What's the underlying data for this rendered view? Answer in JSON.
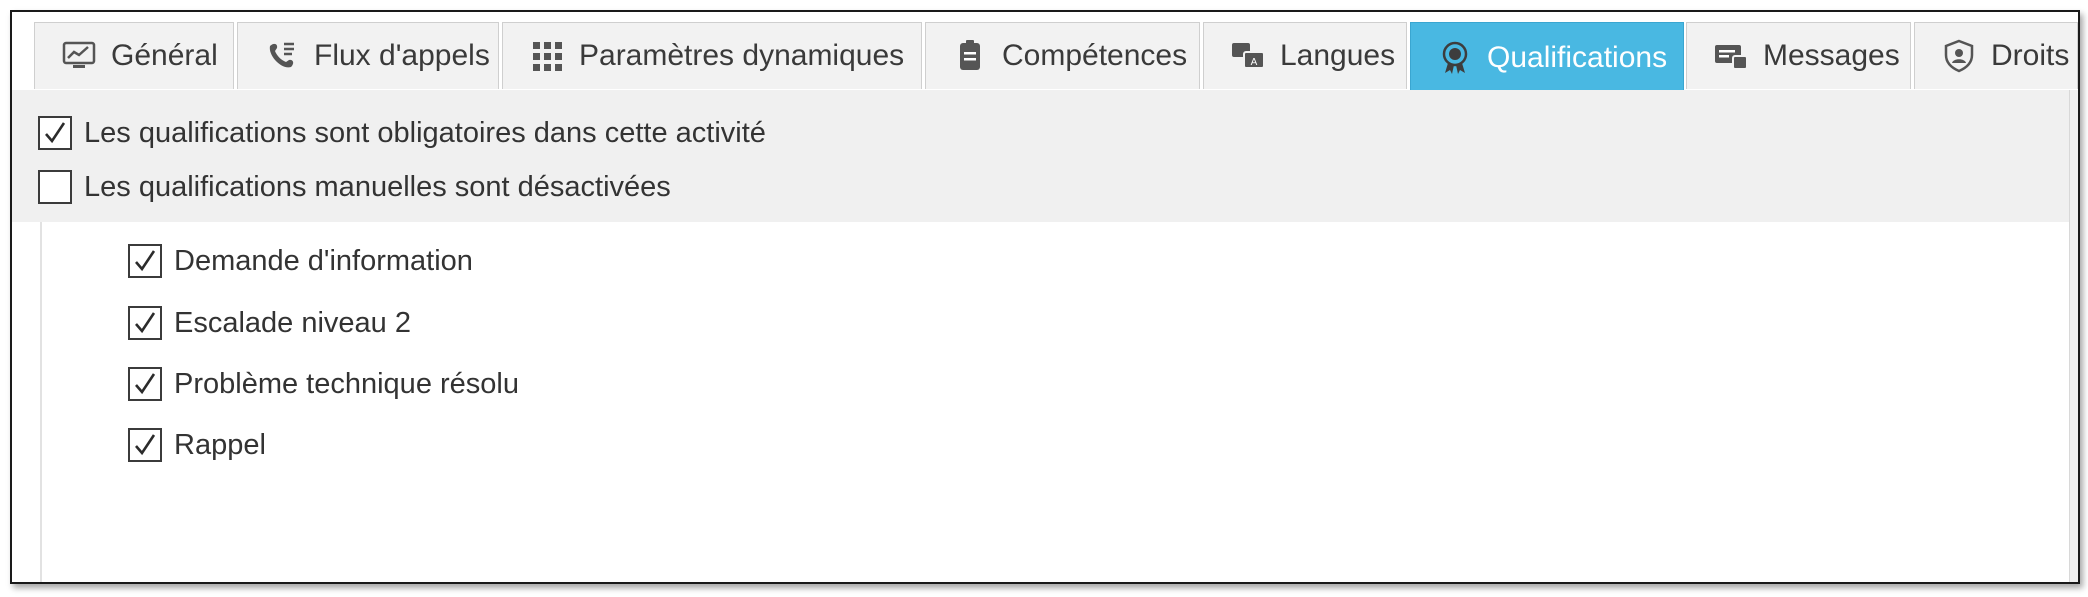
{
  "tabs": [
    {
      "label": "Général",
      "icon": "monitor-chart-icon",
      "active": false
    },
    {
      "label": "Flux d'appels",
      "icon": "call-flow-icon",
      "active": false
    },
    {
      "label": "Paramètres dynamiques",
      "icon": "grid-dots-icon",
      "active": false
    },
    {
      "label": "Compétences",
      "icon": "badge-skills-icon",
      "active": false
    },
    {
      "label": "Langues",
      "icon": "translate-icon",
      "active": false
    },
    {
      "label": "Qualifications",
      "icon": "award-ribbon-icon",
      "active": true
    },
    {
      "label": "Messages",
      "icon": "message-card-icon",
      "active": false
    },
    {
      "label": "Droits",
      "icon": "shield-user-icon",
      "active": false
    }
  ],
  "options": {
    "mandatory": {
      "label": "Les qualifications sont obligatoires dans cette activité",
      "checked": true
    },
    "manual_disabled": {
      "label": "Les qualifications manuelles sont désactivées",
      "checked": false
    }
  },
  "qualifications": [
    {
      "label": "Demande d'information",
      "checked": true
    },
    {
      "label": "Escalade niveau 2",
      "checked": true
    },
    {
      "label": "Problème technique résolu",
      "checked": true
    },
    {
      "label": "Rappel",
      "checked": true
    }
  ],
  "colors": {
    "active_tab": "#49b8e2",
    "tab_bg": "#f2f2f2",
    "panel_bg": "#f0f0f0"
  }
}
